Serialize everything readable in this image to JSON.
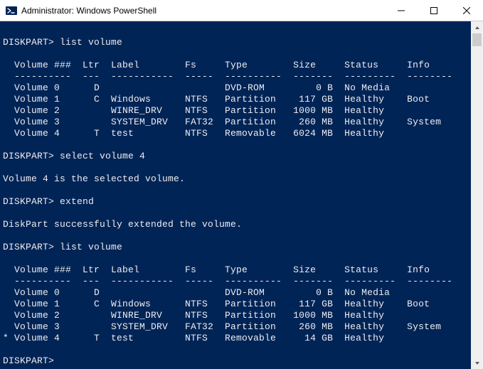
{
  "window": {
    "title": "Administrator: Windows PowerShell"
  },
  "session": {
    "prompt": "DISKPART>",
    "cmd_list_volume": "list volume",
    "cmd_select": "select volume 4",
    "cmd_extend": "extend",
    "msg_selected": "Volume 4 is the selected volume.",
    "msg_extended": "DiskPart successfully extended the volume."
  },
  "header": {
    "vol": "Volume ###",
    "ltr": "Ltr",
    "label": "Label",
    "fs": "Fs",
    "type": "Type",
    "size": "Size",
    "status": "Status",
    "info": "Info"
  },
  "dashes": {
    "vol": "----------",
    "ltr": "---",
    "label": "-----------",
    "fs": "-----",
    "type": "----------",
    "size": "-------",
    "status": "---------",
    "info": "--------"
  },
  "table1": [
    {
      "mark": " ",
      "vol": "Volume 0",
      "ltr": "D",
      "label": "",
      "fs": "",
      "type": "DVD-ROM",
      "size": "0 B",
      "status": "No Media",
      "info": ""
    },
    {
      "mark": " ",
      "vol": "Volume 1",
      "ltr": "C",
      "label": "Windows",
      "fs": "NTFS",
      "type": "Partition",
      "size": "117 GB",
      "status": "Healthy",
      "info": "Boot"
    },
    {
      "mark": " ",
      "vol": "Volume 2",
      "ltr": "",
      "label": "WINRE_DRV",
      "fs": "NTFS",
      "type": "Partition",
      "size": "1000 MB",
      "status": "Healthy",
      "info": ""
    },
    {
      "mark": " ",
      "vol": "Volume 3",
      "ltr": "",
      "label": "SYSTEM_DRV",
      "fs": "FAT32",
      "type": "Partition",
      "size": "260 MB",
      "status": "Healthy",
      "info": "System"
    },
    {
      "mark": " ",
      "vol": "Volume 4",
      "ltr": "T",
      "label": "test",
      "fs": "NTFS",
      "type": "Removable",
      "size": "6024 MB",
      "status": "Healthy",
      "info": ""
    }
  ],
  "table2": [
    {
      "mark": " ",
      "vol": "Volume 0",
      "ltr": "D",
      "label": "",
      "fs": "",
      "type": "DVD-ROM",
      "size": "0 B",
      "status": "No Media",
      "info": ""
    },
    {
      "mark": " ",
      "vol": "Volume 1",
      "ltr": "C",
      "label": "Windows",
      "fs": "NTFS",
      "type": "Partition",
      "size": "117 GB",
      "status": "Healthy",
      "info": "Boot"
    },
    {
      "mark": " ",
      "vol": "Volume 2",
      "ltr": "",
      "label": "WINRE_DRV",
      "fs": "NTFS",
      "type": "Partition",
      "size": "1000 MB",
      "status": "Healthy",
      "info": ""
    },
    {
      "mark": " ",
      "vol": "Volume 3",
      "ltr": "",
      "label": "SYSTEM_DRV",
      "fs": "FAT32",
      "type": "Partition",
      "size": "260 MB",
      "status": "Healthy",
      "info": "System"
    },
    {
      "mark": "*",
      "vol": "Volume 4",
      "ltr": "T",
      "label": "test",
      "fs": "NTFS",
      "type": "Removable",
      "size": "14 GB",
      "status": "Healthy",
      "info": ""
    }
  ]
}
